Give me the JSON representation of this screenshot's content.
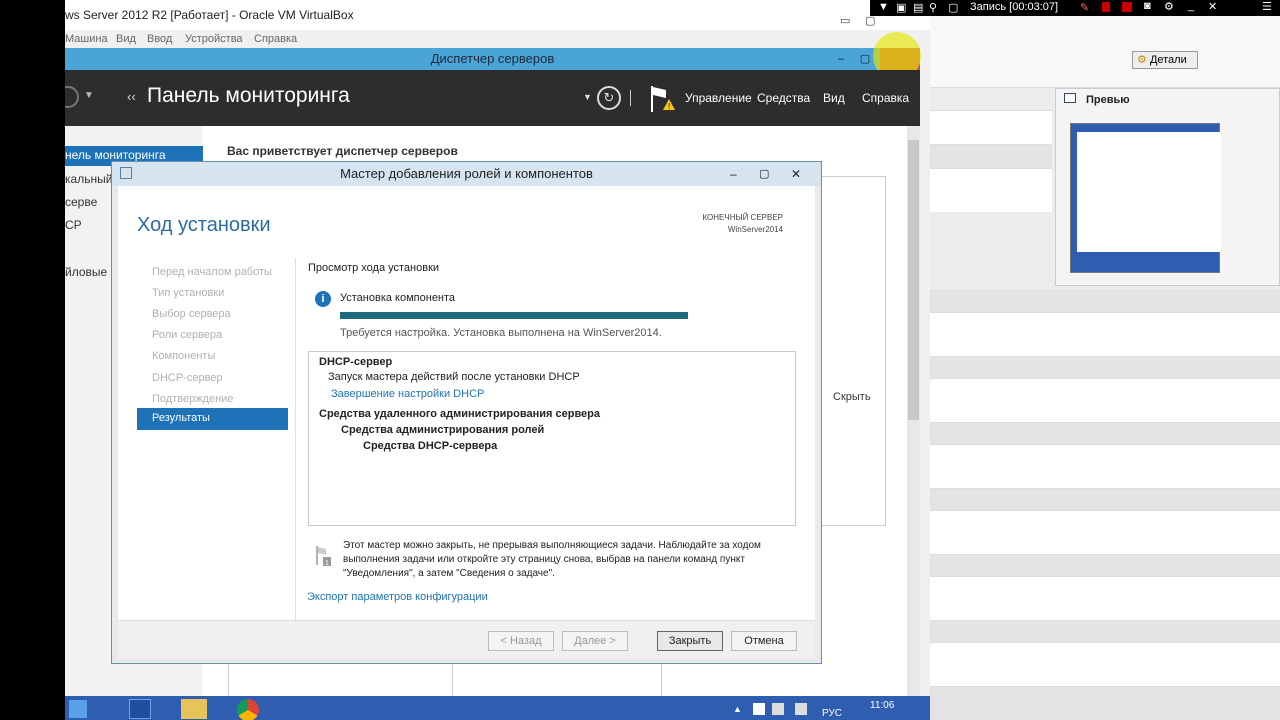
{
  "vbox": {
    "title": "ws Server 2012 R2 [Работает] - Oracle VM VirtualBox",
    "menu": [
      "Машина",
      "Вид",
      "Ввод",
      "Устройства",
      "Справка"
    ]
  },
  "server_manager": {
    "title": "Диспетчер серверов",
    "header_title": "Панель мониторинга",
    "menu": [
      "Управление",
      "Средства",
      "Вид",
      "Справка"
    ],
    "nav": [
      "нель мониторинга",
      "кальный",
      "серве",
      "CP",
      "йловые с"
    ],
    "welcome": "Вас приветствует диспетчер серверов",
    "hide": "Скрыть"
  },
  "wizard": {
    "title": "Мастер добавления ролей и компонентов",
    "heading": "Ход установки",
    "dest_label": "КОНЕЧНЫЙ СЕРВЕР",
    "dest_server": "WinServer2014",
    "steps": [
      "Перед началом работы",
      "Тип установки",
      "Выбор сервера",
      "Роли сервера",
      "Компоненты",
      "DHCP-сервер",
      "Подтверждение"
    ],
    "selected_step": "Результаты",
    "view_progress": "Просмотр хода установки",
    "status_title": "Установка компонента",
    "progress": 1.0,
    "status_text": "Требуется настройка. Установка выполнена на WinServer2014.",
    "results": {
      "dhcp": "DHCP-сервер",
      "dhcp_sub": "Запуск мастера действий после установки DHCP",
      "dhcp_link": "Завершение настройки DHCP",
      "rsat": "Средства удаленного администрирования сервера",
      "role_tools": "Средства администрирования ролей",
      "dhcp_tools": "Средства DHCP-сервера"
    },
    "note": [
      "Этот мастер можно закрыть, не прерывая выполняющиеся задачи. Наблюдайте за ходом",
      "выполнения задачи или откройте эту страницу снова, выбрав на панели команд пункт",
      "\"Уведомления\", а затем \"Сведения о задаче\"."
    ],
    "export_link": "Экспорт параметров конфигурации",
    "buttons": {
      "back": "< Назад",
      "next": "Далее >",
      "close": "Закрыть",
      "cancel": "Отмена"
    }
  },
  "taskbar": {
    "time": "11:06",
    "lang": "РУС"
  },
  "recorder": {
    "label": "Запись [00:03:07]"
  },
  "right_panel": {
    "details": "Детали",
    "preview": "Превью"
  }
}
